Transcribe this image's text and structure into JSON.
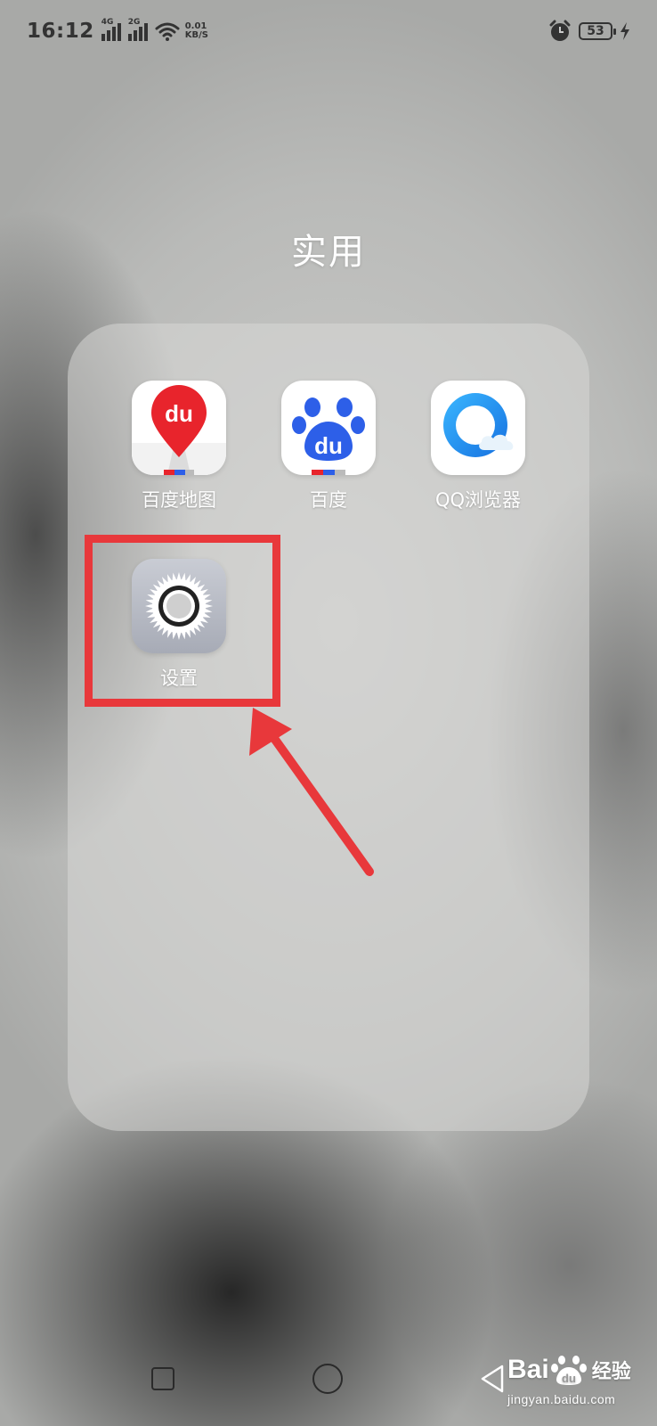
{
  "status_bar": {
    "time": "16:12",
    "network_1": "4G",
    "network_2": "2G",
    "speed_value": "0.01",
    "speed_unit": "KB/S",
    "battery": "53"
  },
  "folder": {
    "title": "实用",
    "apps": [
      {
        "label": "百度地图",
        "icon": "baidu-map-icon"
      },
      {
        "label": "百度",
        "icon": "baidu-icon"
      },
      {
        "label": "QQ浏览器",
        "icon": "qq-browser-icon"
      },
      {
        "label": "设置",
        "icon": "settings-gear-icon"
      }
    ]
  },
  "icon_text": {
    "map_du": "du",
    "baidu_du": "du"
  },
  "watermark": {
    "brand_bai": "Bai",
    "brand_du": "du",
    "brand_jy": "经验",
    "url": "jingyan.baidu.com"
  },
  "colors": {
    "highlight": "#e8383b",
    "baidu_blue": "#2d5fe8",
    "map_red": "#e8242c",
    "qq_blue": "#1a8ff0"
  }
}
